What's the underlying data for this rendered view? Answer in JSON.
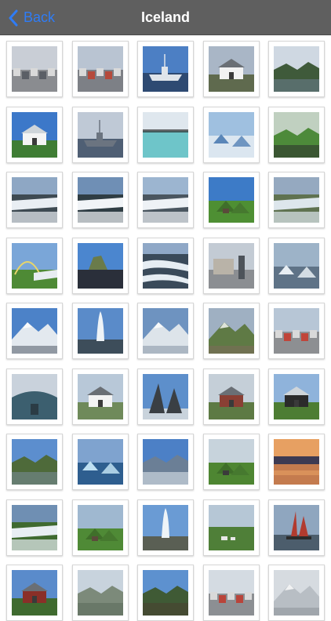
{
  "navbar": {
    "back_label": "Back",
    "title": "Iceland",
    "accent_color": "#2f7cf6",
    "background_color": "#5f5f5f",
    "back_icon": "chevron-left-icon"
  },
  "gallery": {
    "photos": [
      {
        "name": "photo-town-street",
        "sky": "#c9ced6",
        "land": "#8a8c90",
        "accent": "#5b5f66",
        "scene": "street"
      },
      {
        "name": "photo-waterfront-buildings",
        "sky": "#b9c4d2",
        "land": "#7d8086",
        "accent": "#b54a3b",
        "scene": "town"
      },
      {
        "name": "photo-harbor-ship",
        "sky": "#4c7fc4",
        "land": "#2e4a72",
        "accent": "#dfe4ea",
        "scene": "ship"
      },
      {
        "name": "photo-white-house",
        "sky": "#a9b6c6",
        "land": "#5f6a4e",
        "accent": "#f2f2f2",
        "scene": "house"
      },
      {
        "name": "photo-modern-building",
        "sky": "#cfd8e2",
        "land": "#3f5a3a",
        "accent": "#6d7f93",
        "scene": "building"
      },
      {
        "name": "photo-white-church",
        "sky": "#3c78c9",
        "land": "#3f7d34",
        "accent": "#f4f4f4",
        "scene": "church"
      },
      {
        "name": "photo-warship",
        "sky": "#bfc9d6",
        "land": "#4f5f74",
        "accent": "#6b7480",
        "scene": "ship"
      },
      {
        "name": "photo-blue-lagoon",
        "sky": "#dfe7ee",
        "land": "#6ec5c9",
        "accent": "#2f2f2f",
        "scene": "lagoon"
      },
      {
        "name": "photo-ice-cave",
        "sky": "#9fc0e0",
        "land": "#dbe6f0",
        "accent": "#5a86b8",
        "scene": "ice"
      },
      {
        "name": "photo-green-canyon",
        "sky": "#c0d0c0",
        "land": "#4d8a3a",
        "accent": "#2b2b2b",
        "scene": "valley"
      },
      {
        "name": "photo-waterfall-wide",
        "sky": "#8ea7c4",
        "land": "#3e4a52",
        "accent": "#e9eef3",
        "scene": "waterfall"
      },
      {
        "name": "photo-waterfall-mist",
        "sky": "#6f8fb5",
        "land": "#2f3d44",
        "accent": "#f1f4f7",
        "scene": "waterfall"
      },
      {
        "name": "photo-waterfall-gullfoss",
        "sky": "#9cb5d0",
        "land": "#4a5660",
        "accent": "#eef2f6",
        "scene": "waterfall"
      },
      {
        "name": "photo-turf-house",
        "sky": "#3d7bc7",
        "land": "#4e8f33",
        "accent": "#5a4a3a",
        "scene": "turf"
      },
      {
        "name": "photo-canyon-falls",
        "sky": "#95a9c0",
        "land": "#5f7250",
        "accent": "#dde6ec",
        "scene": "waterfall"
      },
      {
        "name": "photo-rainbow-falls",
        "sky": "#7aa6d8",
        "land": "#4e8a35",
        "accent": "#e7ecf1",
        "scene": "rainbow"
      },
      {
        "name": "photo-rock-beach",
        "sky": "#4b86cf",
        "land": "#2a2f3a",
        "accent": "#6a7b4a",
        "scene": "rock"
      },
      {
        "name": "photo-rapids",
        "sky": "#8fa8c7",
        "land": "#3a4a5a",
        "accent": "#e6edf3",
        "scene": "rapids"
      },
      {
        "name": "photo-statue-church",
        "sky": "#c3cbd4",
        "land": "#8b8e92",
        "accent": "#4d535a",
        "scene": "statue"
      },
      {
        "name": "photo-glacier-lagoon",
        "sky": "#9db3c8",
        "land": "#5f7387",
        "accent": "#e8eef3",
        "scene": "icebergs"
      },
      {
        "name": "photo-snow-mountain",
        "sky": "#4c82c8",
        "land": "#e3e9ef",
        "accent": "#5a6470",
        "scene": "mountain"
      },
      {
        "name": "photo-geyser",
        "sky": "#5a8bc9",
        "land": "#3d4d5a",
        "accent": "#eef3f7",
        "scene": "geyser"
      },
      {
        "name": "photo-glacier-plain",
        "sky": "#6e93c0",
        "land": "#dde4ea",
        "accent": "#8c9aa8",
        "scene": "snow"
      },
      {
        "name": "photo-volcano-ash",
        "sky": "#9fb0c2",
        "land": "#5f7a45",
        "accent": "#7b6b5a",
        "scene": "volcano"
      },
      {
        "name": "photo-reykjavik-roofs",
        "sky": "#b7c6d6",
        "land": "#8d8f92",
        "accent": "#c0453a",
        "scene": "roofs"
      },
      {
        "name": "photo-harpa-entrance",
        "sky": "#c9d2dc",
        "land": "#3c5f6f",
        "accent": "#2b3c45",
        "scene": "harpa"
      },
      {
        "name": "photo-white-manor",
        "sky": "#b8c8d8",
        "land": "#6f8a5a",
        "accent": "#f3f3f3",
        "scene": "manor"
      },
      {
        "name": "photo-sculpture",
        "sky": "#5d8fcb",
        "land": "#3a3f44",
        "accent": "#c9d3dc",
        "scene": "sculpture"
      },
      {
        "name": "photo-red-building",
        "sky": "#c5cfd8",
        "land": "#5d7a44",
        "accent": "#8a3f34",
        "scene": "manor"
      },
      {
        "name": "photo-black-church",
        "sky": "#8fb3db",
        "land": "#4d7d33",
        "accent": "#2b2b2b",
        "scene": "church"
      },
      {
        "name": "photo-fjord-hills",
        "sky": "#5c8ece",
        "land": "#4e6a3a",
        "accent": "#7a8d9c",
        "scene": "fjord"
      },
      {
        "name": "photo-blue-iceberg",
        "sky": "#7fa3cf",
        "land": "#2e5e8f",
        "accent": "#bfe0f2",
        "scene": "icebergs"
      },
      {
        "name": "photo-sea-mountain",
        "sky": "#4c80c6",
        "land": "#6b7f96",
        "accent": "#e6edf3",
        "scene": "fjord"
      },
      {
        "name": "photo-turf-church",
        "sky": "#c7d3dc",
        "land": "#4e8632",
        "accent": "#3b3b3b",
        "scene": "turf"
      },
      {
        "name": "photo-sunset-reflection",
        "sky": "#c47b4e",
        "land": "#3d3a52",
        "accent": "#e7a062",
        "scene": "sunset"
      },
      {
        "name": "photo-seljalandsfoss",
        "sky": "#6f8fb3",
        "land": "#3f6a30",
        "accent": "#e8eef3",
        "scene": "waterfall"
      },
      {
        "name": "photo-turf-houses",
        "sky": "#9fb8d0",
        "land": "#4f8a36",
        "accent": "#5b4b3b",
        "scene": "turf"
      },
      {
        "name": "photo-strokkur",
        "sky": "#6a9bd4",
        "land": "#5a5f54",
        "accent": "#eef4f8",
        "scene": "geyser"
      },
      {
        "name": "photo-farm-plain",
        "sky": "#b6c7d6",
        "land": "#4f7f38",
        "accent": "#e8e8e8",
        "scene": "farm"
      },
      {
        "name": "photo-red-sailboat",
        "sky": "#8fa6bf",
        "land": "#4c5d6c",
        "accent": "#b23b2f",
        "scene": "sail"
      },
      {
        "name": "photo-red-house-partial",
        "sky": "#5a8bcb",
        "land": "#3f6a2f",
        "accent": "#8a2f28",
        "scene": "house"
      },
      {
        "name": "photo-hills-partial",
        "sky": "#c8d3dd",
        "land": "#7c8a7a",
        "accent": "#5a6a5a",
        "scene": "valley"
      },
      {
        "name": "photo-tree-partial",
        "sky": "#5d91cf",
        "land": "#3f5a35",
        "accent": "#4a3f30",
        "scene": "valley"
      },
      {
        "name": "photo-roofs-partial",
        "sky": "#d4dbe2",
        "land": "#8c8f93",
        "accent": "#b9443a",
        "scene": "roofs"
      },
      {
        "name": "photo-fog-partial",
        "sky": "#d6dbe0",
        "land": "#b8bec4",
        "accent": "#8f969c",
        "scene": "snow"
      }
    ]
  }
}
